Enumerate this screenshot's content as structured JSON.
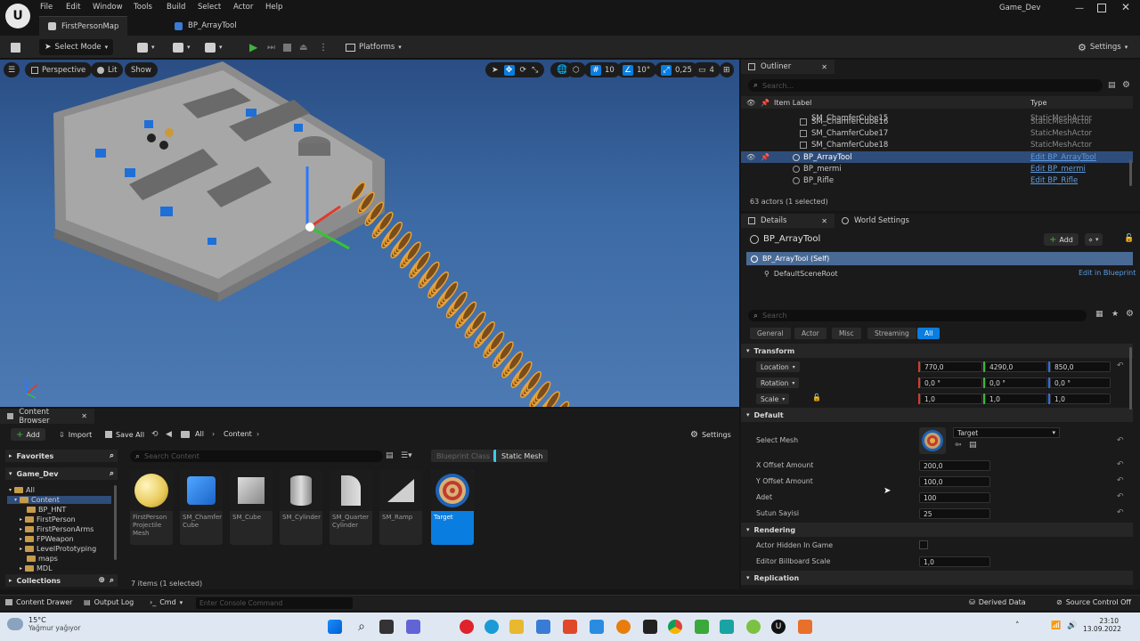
{
  "menu": [
    "File",
    "Edit",
    "Window",
    "Tools",
    "Build",
    "Select",
    "Actor",
    "Help"
  ],
  "project_name": "Game_Dev",
  "tabs": [
    {
      "label": "FirstPersonMap"
    },
    {
      "label": "BP_ArrayTool"
    }
  ],
  "toolbar": {
    "select_mode": "Select Mode",
    "platforms": "Platforms",
    "settings": "Settings"
  },
  "viewport": {
    "perspective": "Perspective",
    "lit": "Lit",
    "show": "Show",
    "grid_snap": "10",
    "rot_snap": "10°",
    "scale_snap": "0,25",
    "cam_speed": "4"
  },
  "outliner": {
    "title": "Outliner",
    "search_placeholder": "Search...",
    "col_label": "Item Label",
    "col_type": "Type",
    "rows": [
      {
        "name": "SM_ChamferCube15",
        "type": "StaticMeshActor",
        "link": false
      },
      {
        "name": "SM_ChamferCube16",
        "type": "StaticMeshActor",
        "link": false
      },
      {
        "name": "SM_ChamferCube17",
        "type": "StaticMeshActor",
        "link": false
      },
      {
        "name": "SM_ChamferCube18",
        "type": "StaticMeshActor",
        "link": false
      },
      {
        "name": "BP_ArrayTool",
        "type": "Edit BP_ArrayTool",
        "link": true
      },
      {
        "name": "BP_mermi",
        "type": "Edit BP_mermi",
        "link": true
      },
      {
        "name": "BP_Rifle",
        "type": "Edit BP_Rifle",
        "link": true
      }
    ],
    "status": "63 actors (1 selected)"
  },
  "details": {
    "tab": "Details",
    "tab2": "World Settings",
    "actor_name": "BP_ArrayTool",
    "add_label": "Add",
    "self_label": "BP_ArrayTool (Self)",
    "root_label": "DefaultSceneRoot",
    "edit_bp": "Edit in Blueprint",
    "search_placeholder": "Search",
    "filters": [
      "General",
      "Actor",
      "Misc",
      "Streaming",
      "All"
    ],
    "transform_title": "Transform",
    "location_label": "Location",
    "rotation_label": "Rotation",
    "scale_label": "Scale",
    "location": [
      "770,0",
      "4290,0",
      "850,0"
    ],
    "rotation": [
      "0,0 °",
      "0,0 °",
      "0,0 °"
    ],
    "scale": [
      "1,0",
      "1,0",
      "1,0"
    ],
    "default_title": "Default",
    "select_mesh_label": "Select Mesh",
    "mesh_value": "Target",
    "x_offset_label": "X Offset Amount",
    "x_offset": "200,0",
    "y_offset_label": "Y Offset Amount",
    "y_offset": "100,0",
    "adet_label": "Adet",
    "adet": "100",
    "sutun_label": "Sutun Sayisi",
    "sutun": "25",
    "rendering_title": "Rendering",
    "hidden_label": "Actor Hidden In Game",
    "billboard_label": "Editor Billboard Scale",
    "billboard": "1,0",
    "replication_title": "Replication"
  },
  "content_browser": {
    "title": "Content Browser",
    "add": "Add",
    "import": "Import",
    "save_all": "Save All",
    "path_all": "All",
    "path_content": "Content",
    "settings": "Settings",
    "favorites": "Favorites",
    "project": "Game_Dev",
    "search_placeholder": "Search Content",
    "filter_bp": "Blueprint Class",
    "filter_sm": "Static Mesh",
    "tree": [
      "All",
      "Content",
      "BP_HNT",
      "FirstPerson",
      "FirstPersonArms",
      "FPWeapon",
      "LevelPrototyping",
      "maps",
      "MDL"
    ],
    "collections": "Collections",
    "assets": [
      {
        "name": "FirstPerson Projectile Mesh"
      },
      {
        "name": "SM_Chamfer Cube"
      },
      {
        "name": "SM_Cube"
      },
      {
        "name": "SM_Cylinder"
      },
      {
        "name": "SM_Quarter Cylinder"
      },
      {
        "name": "SM_Ramp"
      },
      {
        "name": "Target"
      }
    ],
    "status": "7 items (1 selected)"
  },
  "statusbar": {
    "drawer": "Content Drawer",
    "output": "Output Log",
    "cmd": "Cmd",
    "console_placeholder": "Enter Console Command",
    "derived": "Derived Data",
    "source": "Source Control Off"
  },
  "taskbar": {
    "temp": "15°C",
    "weather": "Yağmur yağıyor",
    "time": "23:10",
    "date": "13.09.2022"
  },
  "colors": {
    "accent": "#0a7de0",
    "selection": "#2f4d7a",
    "play": "#41b341",
    "link": "#5c9be0",
    "orange": "#e8a23a"
  }
}
